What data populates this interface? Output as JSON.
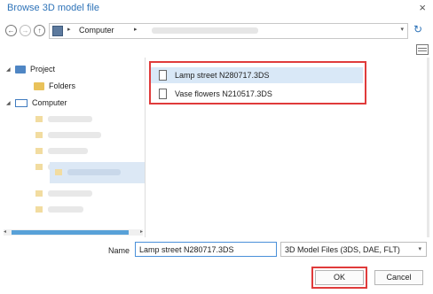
{
  "window": {
    "title": "Browse 3D model file",
    "close_glyph": "×"
  },
  "nav": {
    "back_glyph": "←",
    "forward_glyph": "→",
    "up_glyph": "↑",
    "address": {
      "segment": "Computer",
      "separator": "▸",
      "dropdown_glyph": "▾",
      "refresh_glyph": "↻"
    }
  },
  "tree": {
    "items": [
      {
        "label": "Project",
        "expand": "◢",
        "icon": "project-icon"
      },
      {
        "label": "Folders",
        "icon": "folder-icon"
      },
      {
        "label": "Computer",
        "expand": "◢",
        "icon": "computer-icon"
      }
    ]
  },
  "files": {
    "items": [
      {
        "name": "Lamp street N280717.3DS",
        "selected": true
      },
      {
        "name": "Vase flowers N210517.3DS",
        "selected": false
      }
    ]
  },
  "footer": {
    "name_label": "Name",
    "name_value": "Lamp street N280717.3DS",
    "filetype": "3D Model Files (3DS, DAE, FLT)",
    "filetype_arrow": "▾",
    "ok_label": "OK",
    "cancel_label": "Cancel"
  },
  "scroll": {
    "left_glyph": "◂",
    "right_glyph": "▸"
  },
  "colors": {
    "accent": "#2e73b8",
    "highlight_border": "#e03b3b",
    "selection": "#d9e8f7"
  }
}
